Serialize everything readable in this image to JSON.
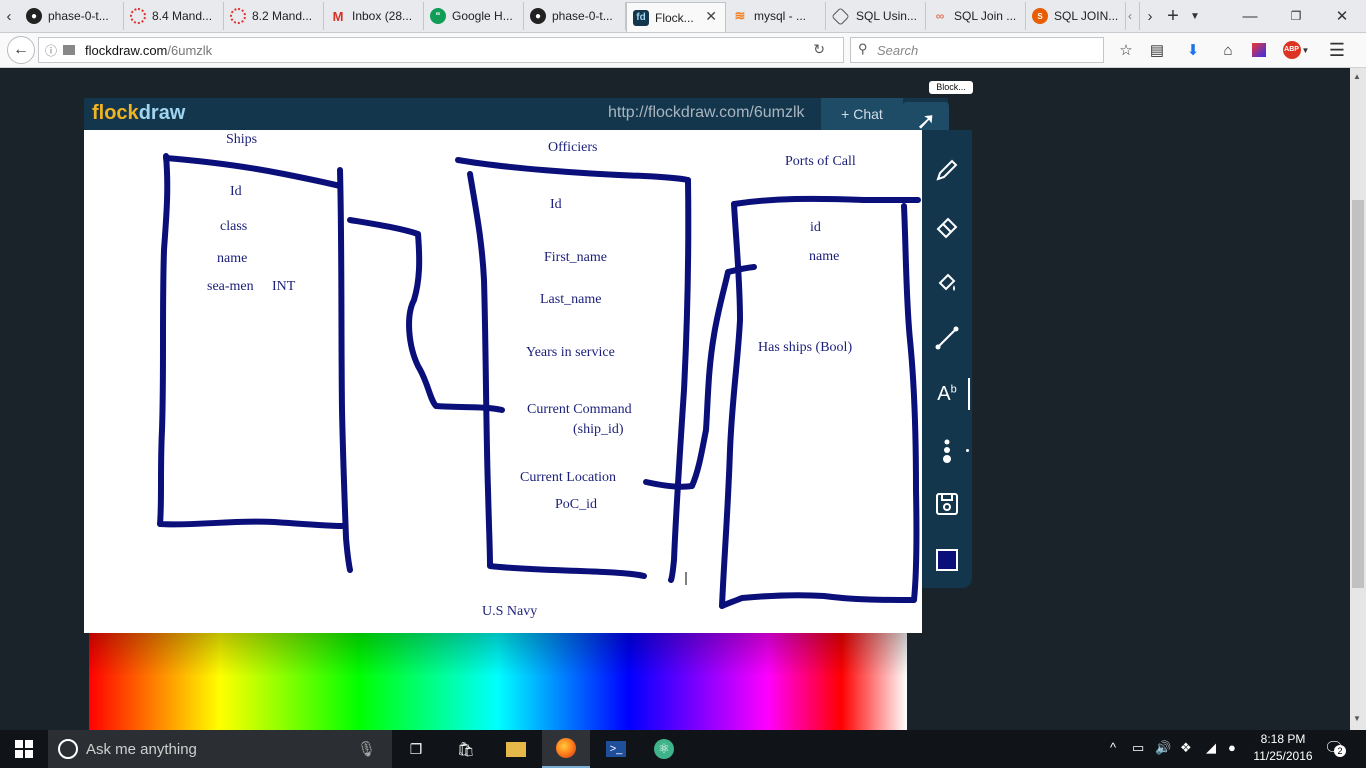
{
  "browser": {
    "tabs": [
      {
        "label": "phase-0-t...",
        "icon": "github-icon"
      },
      {
        "label": "8.4 Mand...",
        "icon": "loading-icon"
      },
      {
        "label": "8.2 Mand...",
        "icon": "loading-icon"
      },
      {
        "label": "Inbox (28...",
        "icon": "gmail-icon"
      },
      {
        "label": "Google H...",
        "icon": "hangouts-icon"
      },
      {
        "label": "phase-0-t...",
        "icon": "github-icon"
      },
      {
        "label": "Flock...",
        "icon": "flockdraw-icon"
      },
      {
        "label": "mysql - ...",
        "icon": "stackoverflow-icon"
      },
      {
        "label": "SQL Usin...",
        "icon": "sql-icon"
      },
      {
        "label": "SQL Join ...",
        "icon": "sql-join-icon"
      },
      {
        "label": "SQL JOIN...",
        "icon": "sql-join2-icon"
      }
    ],
    "active_tab": 6,
    "url_host": "flockdraw.com",
    "url_path": "/6umzlk",
    "search_placeholder": "Search"
  },
  "flockdraw": {
    "logo_a": "flock",
    "logo_b": "draw",
    "share_url": "http://flockdraw.com/6umzlk",
    "chat_label": "+ Chat",
    "block_tag": "Block...",
    "color_accent": "#13364d"
  },
  "canvas": {
    "pen_color": "#0a0f7a",
    "labels": {
      "ships": "Ships",
      "ships_id": "Id",
      "ships_class": "class",
      "ships_name": "name",
      "ships_seamen": "sea-men",
      "ships_int": "INT",
      "officers": "Officiers",
      "off_id": "Id",
      "off_first": "First_name",
      "off_last": "Last_name",
      "off_years": "Years in service",
      "off_cmd": "Current Command",
      "off_shipid": "(ship_id)",
      "off_loc": "Current Location",
      "off_poc": "PoC_id",
      "ports": "Ports of Call",
      "ports_id": "id",
      "ports_name": "name",
      "ports_has": "Has ships (Bool)",
      "navy": "U.S Navy"
    }
  },
  "taskbar": {
    "search_placeholder": "Ask me anything",
    "time": "8:18 PM",
    "date": "11/25/2016",
    "notifications": "2"
  }
}
